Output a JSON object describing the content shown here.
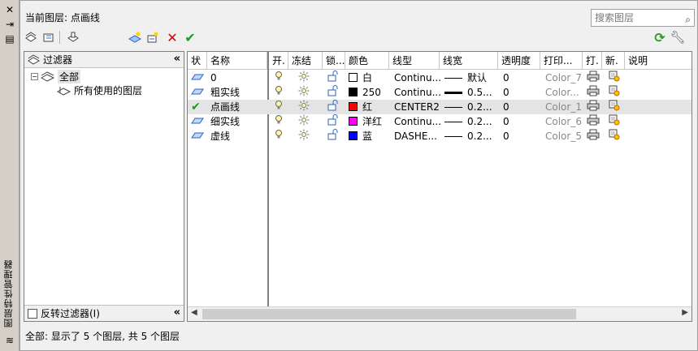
{
  "palette": {
    "title_vertical": "图层特性管理器"
  },
  "header": {
    "current_layer_label": "当前图层: 点画线",
    "search_placeholder": "搜索图层"
  },
  "filters": {
    "title": "过滤器",
    "tree": [
      {
        "label": "全部",
        "expanded": "−"
      },
      {
        "label": "所有使用的图层"
      }
    ],
    "invert_label": "反转过滤器(I)"
  },
  "columns": [
    "状",
    "名称",
    "开.",
    "冻结",
    "锁...",
    "颜色",
    "线型",
    "线宽",
    "透明度",
    "打印...",
    "打.",
    "新.",
    "说明"
  ],
  "layers": [
    {
      "status_icon": "layer-icon",
      "name": "0",
      "color_name": "白",
      "color_hex": "#ffffff",
      "linetype": "Continu...",
      "lineweight": "默认",
      "lw_thickness": "1",
      "transparency": "0",
      "plot_style": "Color_7"
    },
    {
      "status_icon": "layer-icon",
      "name": "粗实线",
      "color_name": "250",
      "color_hex": "#000000",
      "linetype": "Continu...",
      "lineweight": "0.5...",
      "lw_thickness": "3",
      "transparency": "0",
      "plot_style": "Color..."
    },
    {
      "status_icon": "current-check-icon",
      "name": "点画线",
      "color_name": "红",
      "color_hex": "#ff0000",
      "linetype": "CENTER2",
      "lineweight": "0.2...",
      "lw_thickness": "1",
      "transparency": "0",
      "plot_style": "Color_1",
      "selected": true
    },
    {
      "status_icon": "layer-icon",
      "name": "细实线",
      "color_name": "洋红",
      "color_hex": "#ff00ff",
      "linetype": "Continu...",
      "lineweight": "0.2...",
      "lw_thickness": "1",
      "transparency": "0",
      "plot_style": "Color_6"
    },
    {
      "status_icon": "layer-icon",
      "name": "虚线",
      "color_name": "蓝",
      "color_hex": "#0000ff",
      "linetype": "DASHE...",
      "lineweight": "0.2...",
      "lw_thickness": "1",
      "transparency": "0",
      "plot_style": "Color_5"
    }
  ],
  "status_bar": "全部: 显示了 5 个图层, 共 5 个图层"
}
